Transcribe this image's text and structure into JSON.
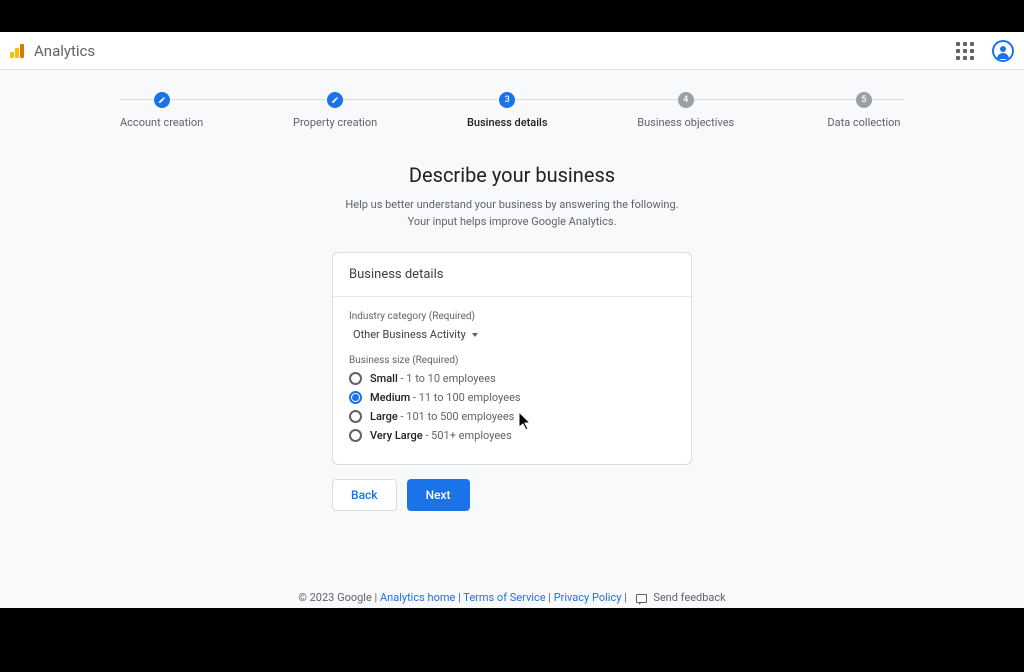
{
  "app": {
    "title": "Analytics"
  },
  "stepper": {
    "steps": [
      {
        "label": "Account creation"
      },
      {
        "label": "Property creation"
      },
      {
        "number": "3",
        "label": "Business details"
      },
      {
        "number": "4",
        "label": "Business objectives"
      },
      {
        "number": "5",
        "label": "Data collection"
      }
    ]
  },
  "page": {
    "heading": "Describe your business",
    "sub1": "Help us better understand your business by answering the following.",
    "sub2": "Your input helps improve Google Analytics."
  },
  "card": {
    "title": "Business details",
    "industry_label": "Industry category (Required)",
    "industry_value": "Other Business Activity",
    "size_label": "Business size (Required)",
    "options": [
      {
        "name": "Small",
        "desc": "1 to 10 employees",
        "selected": false
      },
      {
        "name": "Medium",
        "desc": "11 to 100 employees",
        "selected": true
      },
      {
        "name": "Large",
        "desc": "101 to 500 employees",
        "selected": false
      },
      {
        "name": "Very Large",
        "desc": "501+ employees",
        "selected": false
      }
    ]
  },
  "buttons": {
    "back": "Back",
    "next": "Next"
  },
  "footer": {
    "copyright": "© 2023 Google",
    "links": {
      "home": "Analytics home",
      "terms": "Terms of Service",
      "privacy": "Privacy Policy"
    },
    "feedback": "Send feedback"
  }
}
